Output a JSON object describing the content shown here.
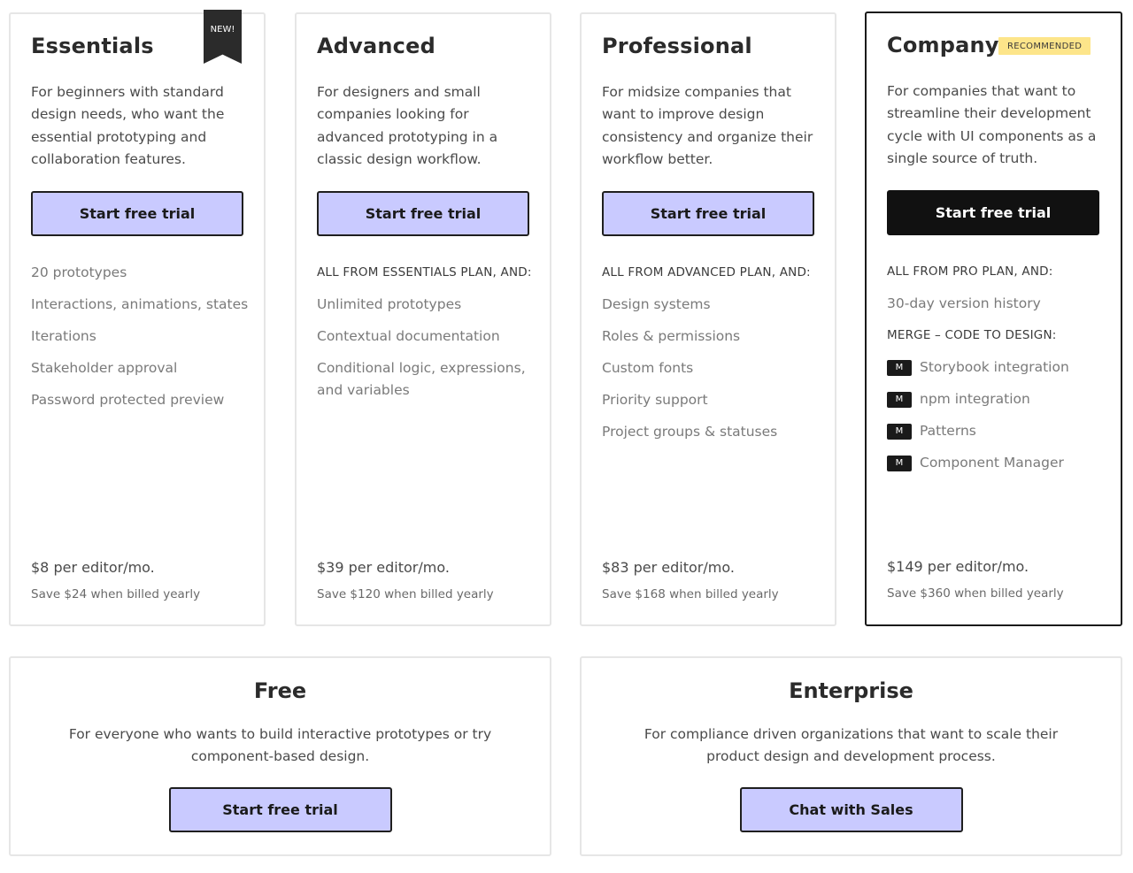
{
  "plans": [
    {
      "name": "Essentials",
      "ribbon": "NEW!",
      "description": "For beginners with standard design needs, who want the essential prototyping and collaboration features.",
      "cta": "Start free trial",
      "features_heading": "",
      "features": [
        "20 prototypes",
        "Interactions, animations, states",
        "Iterations",
        "Stakeholder approval",
        "Password protected preview"
      ],
      "price": "$8 per editor/mo.",
      "savings": "Save $24 when billed yearly"
    },
    {
      "name": "Advanced",
      "description": "For designers and small companies looking for advanced prototyping in a classic design workflow.",
      "cta": "Start free trial",
      "features_heading": "ALL FROM ESSENTIALS PLAN, AND:",
      "features": [
        "Unlimited prototypes",
        "Contextual documentation",
        "Conditional logic, expressions, and variables"
      ],
      "price": "$39 per editor/mo.",
      "savings": "Save $120 when billed yearly"
    },
    {
      "name": "Professional",
      "description": "For midsize companies that want to improve design consistency and organize their workflow better.",
      "cta": "Start free trial",
      "features_heading": "ALL FROM ADVANCED PLAN, AND:",
      "features": [
        "Design systems",
        "Roles & permissions",
        "Custom fonts",
        "Priority support",
        "Project groups & statuses"
      ],
      "price": "$83 per editor/mo.",
      "savings": "Save $168 when billed yearly"
    },
    {
      "name": "Company",
      "badge": "RECOMMENDED",
      "description": "For companies that want to streamline their development cycle with UI components as a single source of truth.",
      "cta": "Start free trial",
      "features_heading": "ALL FROM PRO PLAN, AND:",
      "features": [
        "30-day version history"
      ],
      "merge_heading": "MERGE – CODE TO DESIGN:",
      "merge_badge": "M",
      "merge_features": [
        "Storybook integration",
        "npm integration",
        "Patterns",
        "Component Manager"
      ],
      "price": "$149 per editor/mo.",
      "savings": "Save $360 when billed yearly"
    }
  ],
  "free": {
    "name": "Free",
    "description": "For everyone who wants to build interactive prototypes or try component-based design.",
    "cta": "Start free trial"
  },
  "enterprise": {
    "name": "Enterprise",
    "description": "For compliance driven organizations that want to scale their product design and development process.",
    "cta": "Chat with Sales"
  },
  "colors": {
    "cta_background": "#c9caff",
    "cta_dark": "#111111",
    "badge_yellow": "#fde58a",
    "border": "#e6e6e6"
  }
}
